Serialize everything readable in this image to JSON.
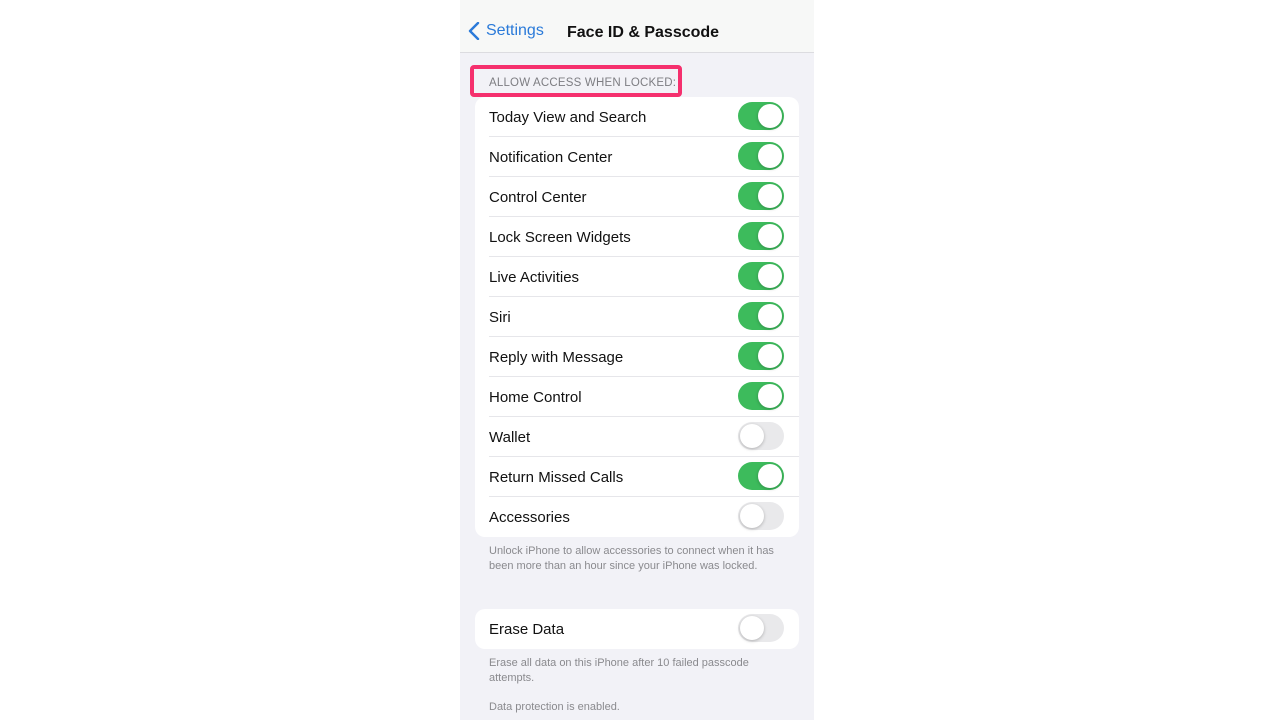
{
  "navbar": {
    "back_label": "Settings",
    "title": "Face ID & Passcode"
  },
  "section_header": "ALLOW ACCESS WHEN LOCKED:",
  "colors": {
    "toggle_on": "#3dbb5c",
    "toggle_off": "#e9e9eb",
    "highlight": "#f5306e",
    "link": "#2a7ad9"
  },
  "locked_access_items": [
    {
      "label": "Today View and Search",
      "on": true
    },
    {
      "label": "Notification Center",
      "on": true
    },
    {
      "label": "Control Center",
      "on": true
    },
    {
      "label": "Lock Screen Widgets",
      "on": true
    },
    {
      "label": "Live Activities",
      "on": true
    },
    {
      "label": "Siri",
      "on": true
    },
    {
      "label": "Reply with Message",
      "on": true
    },
    {
      "label": "Home Control",
      "on": true
    },
    {
      "label": "Wallet",
      "on": false
    },
    {
      "label": "Return Missed Calls",
      "on": true
    },
    {
      "label": "Accessories",
      "on": false
    }
  ],
  "accessories_footer": "Unlock iPhone to allow accessories to connect when it has been more than an hour since your iPhone was locked.",
  "erase": {
    "label": "Erase Data",
    "on": false
  },
  "erase_footer": "Erase all data on this iPhone after 10 failed passcode attempts.",
  "protection_footer": "Data protection is enabled."
}
